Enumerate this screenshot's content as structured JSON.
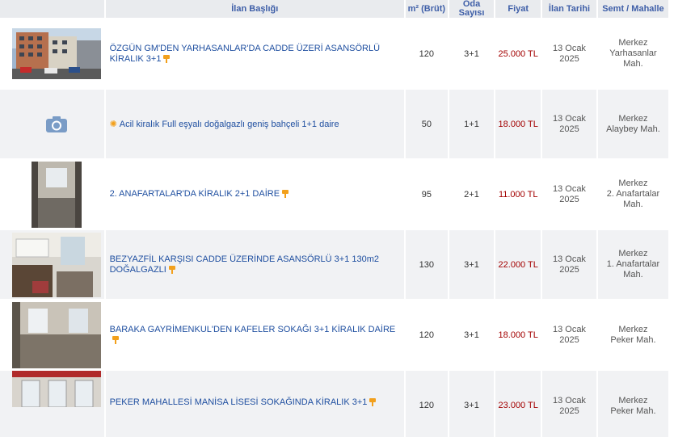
{
  "headers": {
    "title": "İlan Başlığı",
    "area": "m² (Brüt)",
    "rooms_line1": "Oda",
    "rooms_line2": "Sayısı",
    "price": "Fiyat",
    "date": "İlan Tarihi",
    "location": "Semt / Mahalle"
  },
  "listings": [
    {
      "title": "ÖZGÜN GM'DEN YARHASANLAR'DA CADDE ÜZERİ ASANSÖRLÜ KİRALIK 3+1",
      "area": "120",
      "rooms": "3+1",
      "price": "25.000 TL",
      "date_line1": "13 Ocak",
      "date_line2": "2025",
      "loc_line1": "Merkez",
      "loc_line2": "Yarhasanlar",
      "loc_line3": "Mah.",
      "photo": "building-street-photo"
    },
    {
      "title": "Acil kiralık Full eşyalı doğalgazlı geniş bahçeli 1+1 daire",
      "area": "50",
      "rooms": "1+1",
      "price": "18.000 TL",
      "date_line1": "13 Ocak",
      "date_line2": "2025",
      "loc_line1": "Merkez",
      "loc_line2": "Alaybey Mah.",
      "photo": "camera-icon"
    },
    {
      "title": "2. ANAFARTALAR'DA KİRALIK 2+1 DAİRE",
      "area": "95",
      "rooms": "2+1",
      "price": "11.000 TL",
      "date_line1": "13 Ocak",
      "date_line2": "2025",
      "loc_line1": "Merkez",
      "loc_line2": "2. Anafartalar",
      "loc_line3": "Mah.",
      "photo": "empty-room-photo"
    },
    {
      "title_line1": "BEZYAZFİL KARŞISI CADDE ÜZERİNDE ASANSÖRLÜ 3+1 130m2",
      "title_line2": "DOĞALGAZLI",
      "area": "130",
      "rooms": "3+1",
      "price": "22.000 TL",
      "date_line1": "13 Ocak",
      "date_line2": "2025",
      "loc_line1": "Merkez",
      "loc_line2": "1. Anafartalar",
      "loc_line3": "Mah.",
      "photo": "kitchen-photo"
    },
    {
      "title": "BARAKA GAYRİMENKUL'DEN KAFELER SOKAĞI 3+1 KİRALIK DAİRE",
      "area": "120",
      "rooms": "3+1",
      "price": "18.000 TL",
      "date_line1": "13 Ocak",
      "date_line2": "2025",
      "loc_line1": "Merkez",
      "loc_line2": "Peker Mah.",
      "photo": "living-room-photo"
    },
    {
      "title": "PEKER MAHALLESİ MANİSA LİSESİ SOKAĞINDA KİRALIK 3+1",
      "area": "120",
      "rooms": "3+1",
      "price": "23.000 TL",
      "date_line1": "13 Ocak",
      "date_line2": "2025",
      "loc_line1": "Merkez",
      "loc_line2": "Peker Mah.",
      "photo": "window-room-photo"
    }
  ],
  "colors": {
    "header_bg": "#e9ebee",
    "header_text": "#3f5fa8",
    "link": "#1f4fa0",
    "price": "#a30000",
    "row_alt": "#f1f2f4",
    "pin": "#f2a01c"
  }
}
